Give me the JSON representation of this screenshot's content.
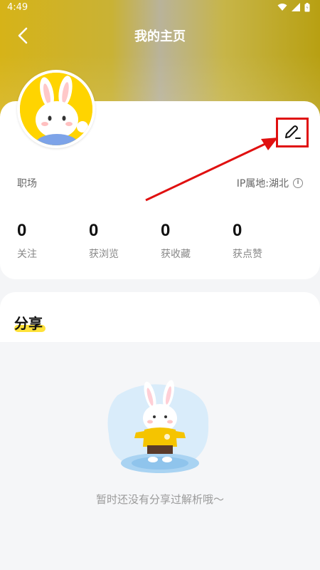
{
  "status_bar": {
    "time": "4:49"
  },
  "nav": {
    "title": "我的主页"
  },
  "profile": {
    "job": "职场",
    "ip_location": "IP属地:湖北",
    "stats": [
      {
        "value": "0",
        "label": "关注"
      },
      {
        "value": "0",
        "label": "获浏览"
      },
      {
        "value": "0",
        "label": "获收藏"
      },
      {
        "value": "0",
        "label": "获点赞"
      }
    ]
  },
  "share": {
    "title": "分享",
    "empty_text": "暂时还没有分享过解析哦～"
  },
  "colors": {
    "accent_yellow": "#ffe23a",
    "annotation_red": "#e01010"
  },
  "icons": {
    "back": "chevron-left-icon",
    "edit": "pencil-icon",
    "info": "info-icon"
  }
}
